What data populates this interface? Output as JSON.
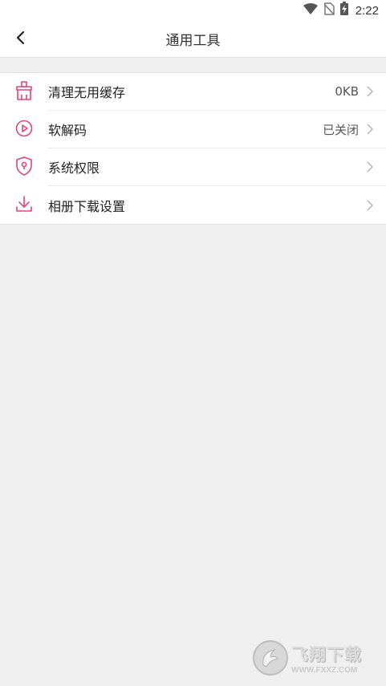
{
  "status_bar": {
    "time": "2:22",
    "icons": [
      "wifi-icon",
      "no-sim-icon",
      "battery-charging-icon"
    ]
  },
  "header": {
    "title": "通用工具",
    "back_icon": "chevron-left-icon"
  },
  "accent_color": "#e0457b",
  "settings": [
    {
      "label": "清理无用缓存",
      "value": "0KB",
      "icon": "broom-icon"
    },
    {
      "label": "软解码",
      "value": "已关闭",
      "icon": "play-circle-icon"
    },
    {
      "label": "系统权限",
      "value": "",
      "icon": "shield-lock-icon"
    },
    {
      "label": "相册下载设置",
      "value": "",
      "icon": "download-icon"
    }
  ],
  "watermark": {
    "name": "飞翔下载",
    "url": "WWW.FXXZ.COM"
  }
}
